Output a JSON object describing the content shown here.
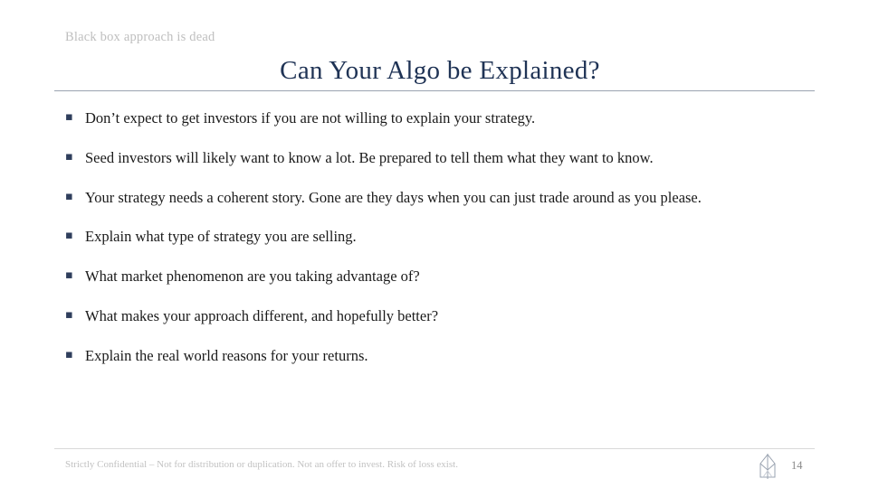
{
  "slide": {
    "eyebrow": "Black box approach is dead",
    "title": "Can Your Algo be Explained?",
    "bullet_marker": "▪",
    "bullets": [
      "Don’t expect to get investors if you are not willing to explain your strategy.",
      "Seed investors will likely want to know a lot. Be prepared to tell them what they want to know.",
      "Your strategy needs a coherent story. Gone are they days when you can just trade around as you please.",
      "Explain what type of strategy you are selling.",
      "What market phenomenon are you taking advantage of?",
      "What makes your approach different, and hopefully better?",
      "Explain the real world reasons for your returns."
    ],
    "footer_note": "Strictly Confidential – Not for distribution or duplication. Not an offer to invest. Risk of loss exist.",
    "page_number": "14",
    "logo_name": "company-logo-icon",
    "colors": {
      "title": "#1f3355",
      "eyebrow": "#bfbfbf",
      "body": "#1a1a1a",
      "footer": "#c2c2c2",
      "rule": "#9aa3b0"
    }
  }
}
